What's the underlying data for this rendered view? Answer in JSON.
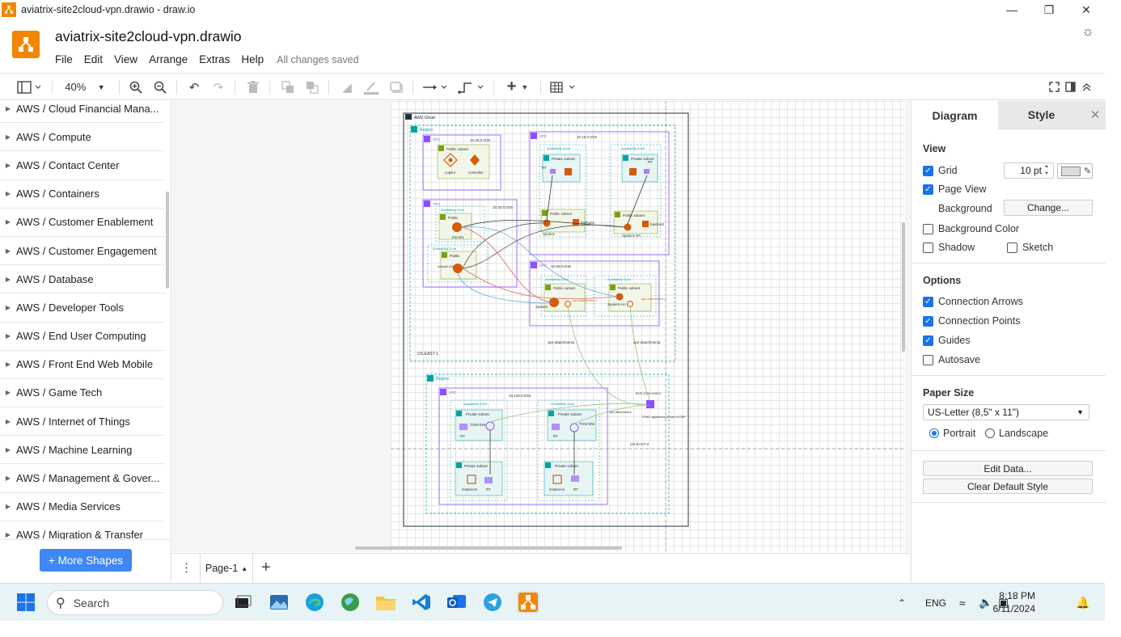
{
  "window": {
    "title": "aviatrix-site2cloud-vpn.drawio - draw.io",
    "controls": [
      "minimize",
      "restore",
      "close"
    ]
  },
  "header": {
    "doc_title": "aviatrix-site2cloud-vpn.drawio",
    "menu": [
      "File",
      "Edit",
      "View",
      "Arrange",
      "Extras",
      "Help"
    ],
    "save_status": "All changes saved"
  },
  "toolbar": {
    "zoom": "40%",
    "icons": [
      "view-panel-icon",
      "zoom-in-icon",
      "zoom-out-icon",
      "undo-icon",
      "redo-icon",
      "delete-icon",
      "to-front-icon",
      "to-back-icon",
      "fill-color-icon",
      "line-color-icon",
      "shadow-icon",
      "connection-icon",
      "waypoints-icon",
      "insert-icon",
      "table-icon",
      "fullscreen-icon",
      "format-panel-icon",
      "collapse-icon"
    ]
  },
  "sidebar": {
    "items": [
      "AWS / Cloud Financial Mana...",
      "AWS / Compute",
      "AWS / Contact Center",
      "AWS / Containers",
      "AWS / Customer Enablement",
      "AWS / Customer Engagement",
      "AWS / Database",
      "AWS / Developer Tools",
      "AWS / End User Computing",
      "AWS / Front End Web Mobile",
      "AWS / Game Tech",
      "AWS / Internet of Things",
      "AWS / Machine Learning",
      "AWS / Management & Gover...",
      "AWS / Media Services",
      "AWS / Migration & Transfer"
    ],
    "more_shapes": "+ More Shapes"
  },
  "diagram": {
    "aws_cloud": "AWS Cloud",
    "region_label": "Region",
    "vpc_label": "VPC",
    "az_label": "Availability Zone",
    "public_subnet": "Public subnet",
    "private_subnet": "Private subnet",
    "public_short": "Public",
    "cidr1": "10.40.0.0/16",
    "cidr2": "10.32.0.0/16",
    "cidr3": "10.16.0.0/16",
    "cidr4": "10.90.0.0/16",
    "cidr5": "10.128.0.0/16",
    "copilot": "copilot",
    "controller": "controller",
    "transit1": "transit1",
    "transit1_ha": "transit1-HA",
    "spoke1": "Spoke1",
    "spoke1_ha": "Spoke1-HA",
    "spoke2": "Spoke2",
    "spoke2_ha": "Spoke2-HA",
    "bastion1": "bastion1",
    "bastion2": "bastion2",
    "rt": "RT",
    "vpn_conn1": "vpn-connection-1",
    "vpn_conn2": "vpn-connection-2",
    "vpn_att1": "vpn-attachment1",
    "vpn_att2": "vpn-attachment2",
    "vpn_att": "vpn-attachment",
    "us_east_1": "US-EAST-1",
    "us_east_2": "US-EAST-2",
    "tgw_eni": "TGW-ENI",
    "instance1": "instance1",
    "instance2": "instance2",
    "bgp": "BGP-ASN=64512",
    "tgw": "TGW1 appliance-mode=ECMP"
  },
  "pagebar": {
    "page_name": "Page-1"
  },
  "format_panel": {
    "tabs": [
      "Diagram",
      "Style"
    ],
    "view": {
      "heading": "View",
      "grid": "Grid",
      "grid_size": "10 pt",
      "page_view": "Page View",
      "background": "Background",
      "change": "Change...",
      "background_color": "Background Color",
      "shadow": "Shadow",
      "sketch": "Sketch"
    },
    "options": {
      "heading": "Options",
      "connection_arrows": "Connection Arrows",
      "connection_points": "Connection Points",
      "guides": "Guides",
      "autosave": "Autosave"
    },
    "paper": {
      "heading": "Paper Size",
      "size": "US-Letter (8,5\" x 11\")",
      "portrait": "Portrait",
      "landscape": "Landscape"
    },
    "edit_data": "Edit Data...",
    "clear_default_style": "Clear Default Style"
  },
  "taskbar": {
    "search": "Search",
    "lang": "ENG",
    "time": "8:18 PM",
    "date": "6/11/2024"
  },
  "colors": {
    "accent": "#1a73e8",
    "drawio_orange": "#f08705",
    "more_shapes_btn": "#3f87f5",
    "aws_vpc": "#8c4fff",
    "aws_region": "#00a4a6",
    "aws_subnet_green": "#7aa116",
    "aws_router": "#d45b07"
  }
}
